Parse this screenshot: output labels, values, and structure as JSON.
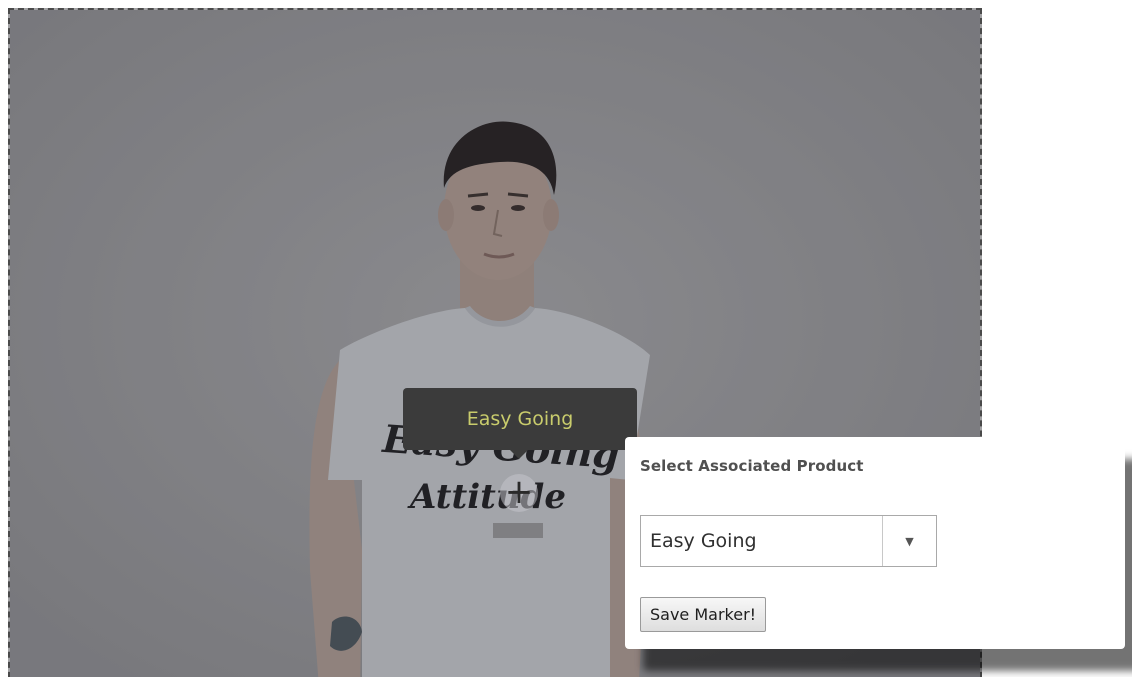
{
  "product_marker": {
    "tooltip_label": "Easy Going",
    "marker_icon": "+"
  },
  "shirt_print_text": {
    "line1": "Easy Going",
    "line2": "Attitude"
  },
  "associate_panel": {
    "title": "Select Associated Product",
    "selected_product": "Easy Going",
    "dropdown_icon": "▼",
    "save_label": "Save Marker!"
  },
  "colors": {
    "tooltip_bg": "#3b3b3b",
    "tooltip_text": "#c9cc6c",
    "panel_bg": "#ffffff",
    "frame_border": "#4a4a4a"
  }
}
